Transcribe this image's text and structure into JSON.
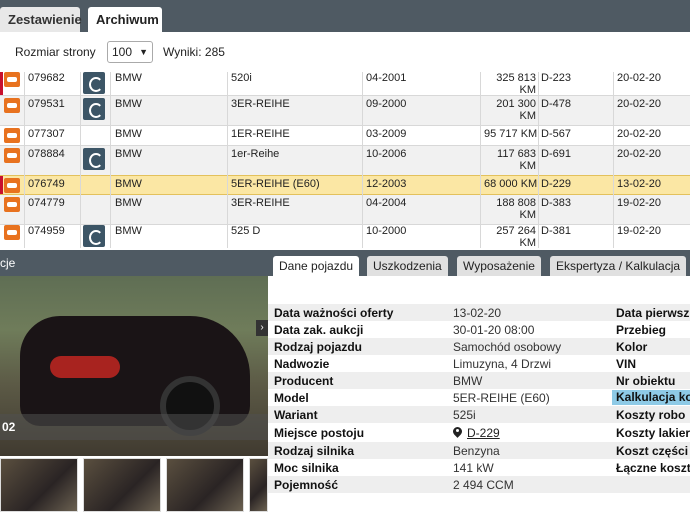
{
  "tabs": [
    {
      "label": "Zestawienie",
      "active": false
    },
    {
      "label": "Archiwum",
      "active": true
    }
  ],
  "filter": {
    "page_size_label": "Rozmiar strony",
    "page_size_value": "100",
    "results_label": "Wyniki: 285"
  },
  "rows": [
    {
      "id": "079682",
      "make": "BMW",
      "model": "520i",
      "date": "04-2001",
      "km1": "325 813",
      "km2": "KM",
      "loc": "D-223",
      "end": "20-02-20",
      "thumb": true
    },
    {
      "id": "079531",
      "make": "BMW",
      "model": "3ER-REIHE",
      "date": "09-2000",
      "km1": "201 300",
      "km2": "KM",
      "loc": "D-478",
      "end": "20-02-20",
      "thumb": true
    },
    {
      "id": "077307",
      "make": "BMW",
      "model": "1ER-REIHE",
      "date": "03-2009",
      "km1": "95 717 KM",
      "km2": "",
      "loc": "D-567",
      "end": "20-02-20",
      "thumb": false
    },
    {
      "id": "078884",
      "make": "BMW",
      "model": "1er-Reihe",
      "date": "10-2006",
      "km1": "117 683",
      "km2": "KM",
      "loc": "D-691",
      "end": "20-02-20",
      "thumb": true
    },
    {
      "id": "076749",
      "make": "BMW",
      "model": "5ER-REIHE (E60)",
      "date": "12-2003",
      "km1": "68 000 KM",
      "km2": "",
      "loc": "D-229",
      "end": "13-02-20",
      "thumb": false
    },
    {
      "id": "074779",
      "make": "BMW",
      "model": "3ER-REIHE",
      "date": "04-2004",
      "km1": "188 808",
      "km2": "KM",
      "loc": "D-383",
      "end": "19-02-20",
      "thumb": false
    },
    {
      "id": "074959",
      "make": "BMW",
      "model": "525 D",
      "date": "10-2000",
      "km1": "257 264",
      "km2": "KM",
      "loc": "D-381",
      "end": "19-02-20",
      "thumb": true
    }
  ],
  "detail": {
    "title": "cje",
    "tabs": [
      "Dane pojazdu",
      "Uszkodzenia",
      "Wyposażenie",
      "Ekspertyza / Kalkulacja"
    ],
    "photo_caption": "02",
    "fields": [
      {
        "label": "Data ważności oferty",
        "value": "13-02-20",
        "right": "Data pierwsz"
      },
      {
        "label": "Data zak. aukcji",
        "value": "30-01-20 08:00",
        "right": "Przebieg"
      },
      {
        "label": "Rodzaj pojazdu",
        "value": "Samochód osobowy",
        "right": "Kolor"
      },
      {
        "label": "Nadwozie",
        "value": "Limuzyna, 4 Drzwi",
        "right": "VIN"
      },
      {
        "label": "Producent",
        "value": "BMW",
        "right": "Nr obiektu"
      },
      {
        "label": "Model",
        "value": "5ER-REIHE (E60)",
        "right": "Kalkulacja ko"
      },
      {
        "label": "Wariant",
        "value": "525i",
        "right": "Koszty robo"
      },
      {
        "label": "Miejsce postoju",
        "value": "D-229",
        "right": "Koszty lakier"
      },
      {
        "label": "Rodzaj silnika",
        "value": "Benzyna",
        "right": "Koszt części"
      },
      {
        "label": "Moc silnika",
        "value": "141 kW",
        "right": "Łączne koszt"
      },
      {
        "label": "Pojemność",
        "value": "2 494 CCM",
        "right": ""
      }
    ]
  }
}
